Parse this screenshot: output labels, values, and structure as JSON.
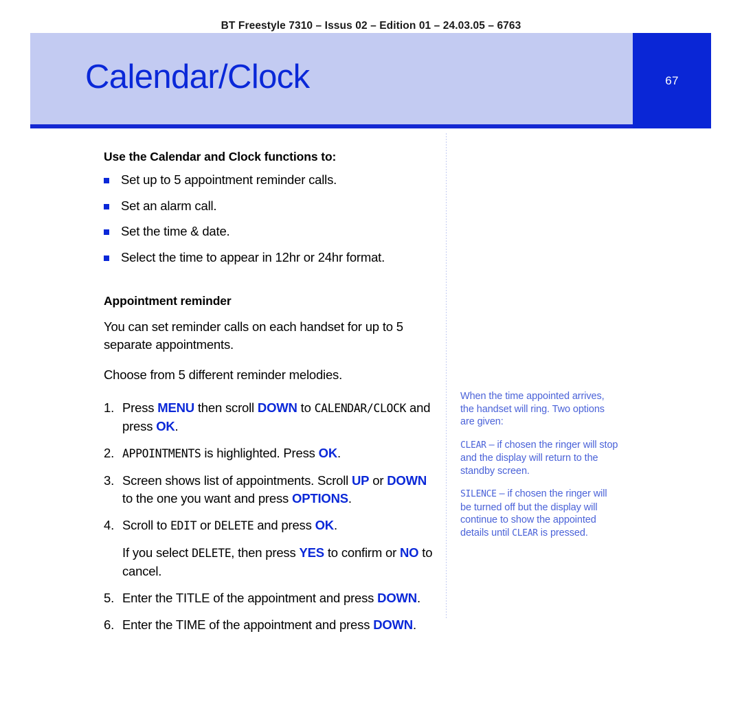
{
  "header": {
    "running_text": "BT Freestyle 7310 – Issus 02 – Edition 01 – 24.03.05 – 6763"
  },
  "banner": {
    "title": "Calendar/Clock",
    "page_number": "67",
    "bg_color": "#c3cbf2",
    "accent_color": "#0a26d6",
    "title_color": "#0a28d8"
  },
  "main": {
    "heading_functions": "Use the Calendar and Clock functions to:",
    "bullets": [
      "Set up to 5 appointment reminder calls.",
      "Set an alarm call.",
      "Set the time & date.",
      "Select the time to appear in 12hr or 24hr format."
    ],
    "heading_appointment": "Appointment reminder",
    "paragraphs": [
      "You can set reminder calls on each handset for up to 5 separate appointments.",
      "Choose from 5 different reminder melodies."
    ],
    "steps": [
      {
        "number": "1.",
        "parts": [
          {
            "text": "Press ",
            "style": "plain"
          },
          {
            "text": "MENU",
            "style": "key"
          },
          {
            "text": " then scroll ",
            "style": "plain"
          },
          {
            "text": "DOWN",
            "style": "key"
          },
          {
            "text": " to ",
            "style": "plain"
          },
          {
            "text": "CALENDAR/CLOCK",
            "style": "lcd"
          },
          {
            "text": " and press ",
            "style": "plain"
          },
          {
            "text": "OK",
            "style": "key"
          },
          {
            "text": ".",
            "style": "plain"
          }
        ]
      },
      {
        "number": "2.",
        "parts": [
          {
            "text": "APPOINTMENTS",
            "style": "lcd"
          },
          {
            "text": " is highlighted. Press ",
            "style": "plain"
          },
          {
            "text": "OK",
            "style": "key"
          },
          {
            "text": ".",
            "style": "plain"
          }
        ]
      },
      {
        "number": "3.",
        "parts": [
          {
            "text": "Screen shows list of appointments. Scroll ",
            "style": "plain"
          },
          {
            "text": "UP",
            "style": "key"
          },
          {
            "text": " or ",
            "style": "plain"
          },
          {
            "text": "DOWN",
            "style": "key"
          },
          {
            "text": " to the one you want and press ",
            "style": "plain"
          },
          {
            "text": "OPTIONS",
            "style": "key"
          },
          {
            "text": ".",
            "style": "plain"
          }
        ]
      },
      {
        "number": "4.",
        "parts": [
          {
            "text": "Scroll to ",
            "style": "plain"
          },
          {
            "text": "EDIT",
            "style": "lcd"
          },
          {
            "text": " or ",
            "style": "plain"
          },
          {
            "text": "DELETE",
            "style": "lcd"
          },
          {
            "text": " and press ",
            "style": "plain"
          },
          {
            "text": "OK",
            "style": "key"
          },
          {
            "text": ".",
            "style": "plain"
          }
        ]
      },
      {
        "number": "",
        "parts": [
          {
            "text": "If you select ",
            "style": "plain"
          },
          {
            "text": "DELETE",
            "style": "lcd"
          },
          {
            "text": ", then press ",
            "style": "plain"
          },
          {
            "text": "YES",
            "style": "key"
          },
          {
            "text": " to confirm or ",
            "style": "plain"
          },
          {
            "text": "NO",
            "style": "key"
          },
          {
            "text": " to cancel.",
            "style": "plain"
          }
        ]
      },
      {
        "number": "5.",
        "parts": [
          {
            "text": "Enter the TITLE of the appointment and press ",
            "style": "plain"
          },
          {
            "text": "DOWN",
            "style": "key"
          },
          {
            "text": ".",
            "style": "plain"
          }
        ]
      },
      {
        "number": "6.",
        "parts": [
          {
            "text": "Enter the TIME of the appointment and press ",
            "style": "plain"
          },
          {
            "text": "DOWN",
            "style": "key"
          },
          {
            "text": ".",
            "style": "plain"
          }
        ]
      }
    ]
  },
  "sidenote": {
    "color": "#4a62d8",
    "paragraphs": [
      [
        {
          "text": "When the time appointed arrives, the handset will ring. Two options are given:",
          "style": "plain"
        }
      ],
      [
        {
          "text": "CLEAR",
          "style": "lcd"
        },
        {
          "text": " – if chosen the ringer will stop and the display will return to the standby screen.",
          "style": "plain"
        }
      ],
      [
        {
          "text": "SILENCE",
          "style": "lcd"
        },
        {
          "text": " – if chosen the ringer will be turned off but the display will continue to show the appointed details until ",
          "style": "plain"
        },
        {
          "text": "CLEAR",
          "style": "lcd"
        },
        {
          "text": " is pressed.",
          "style": "plain"
        }
      ]
    ]
  }
}
